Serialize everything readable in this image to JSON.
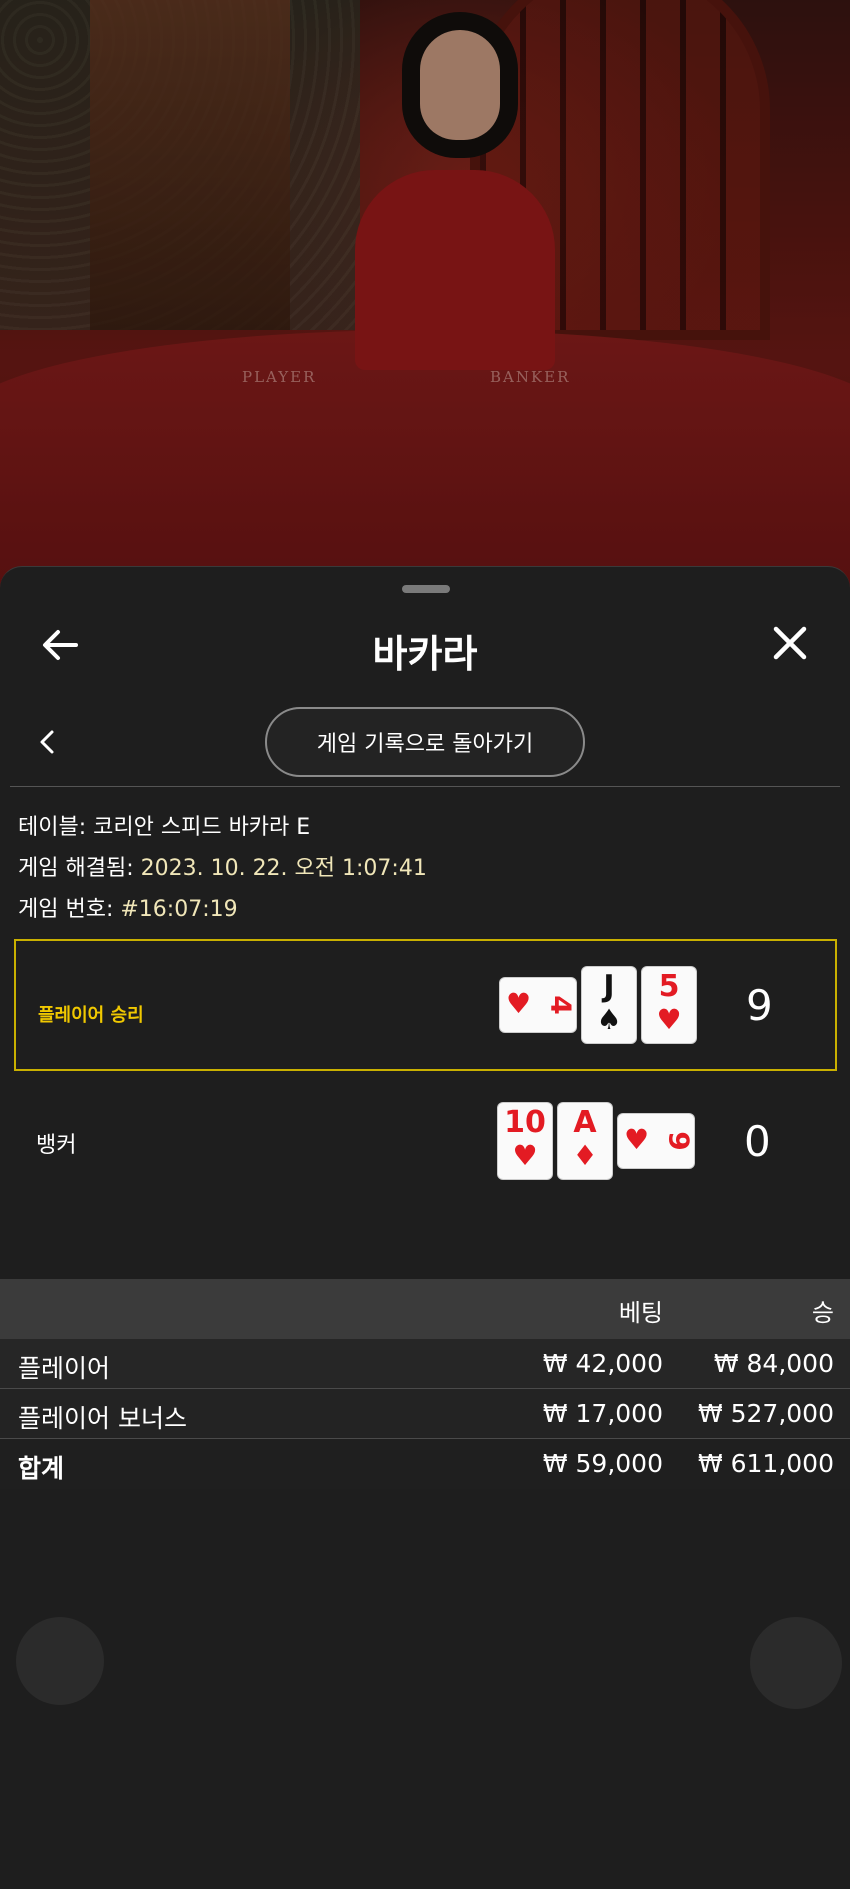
{
  "video": {
    "table_labels": [
      "PLAYER",
      "BANKER"
    ]
  },
  "sheet": {
    "title": "바카라",
    "back_icon": "arrow-left-icon",
    "close_icon": "close-icon",
    "history_button": "게임 기록으로 돌아가기",
    "info": {
      "table_label": "테이블:",
      "table_value": "코리안 스피드 바카라 E",
      "resolved_label": "게임 해결됨:",
      "resolved_value": "2023. 10. 22. 오전 1:07:41",
      "number_label": "게임 번호:",
      "number_value": "#16:07:19"
    },
    "results": {
      "player": {
        "label": "플레이어 승리",
        "cards": [
          {
            "rank": "4",
            "suit": "♥",
            "color": "#e31b23",
            "orientation": "side"
          },
          {
            "rank": "J",
            "suit": "♠",
            "color": "#111111",
            "orientation": "up"
          },
          {
            "rank": "5",
            "suit": "♥",
            "color": "#e31b23",
            "orientation": "up"
          }
        ],
        "score": "9"
      },
      "banker": {
        "label": "뱅커",
        "cards": [
          {
            "rank": "10",
            "suit": "♥",
            "color": "#e31b23",
            "orientation": "up"
          },
          {
            "rank": "A",
            "suit": "♦",
            "color": "#e31b23",
            "orientation": "up"
          },
          {
            "rank": "9",
            "suit": "♥",
            "color": "#e31b23",
            "orientation": "side"
          }
        ],
        "score": "0"
      }
    },
    "bets": {
      "headers": {
        "bet": "베팅",
        "win": "승"
      },
      "rows": [
        {
          "name": "플레이어",
          "bet": "₩ 42,000",
          "win": "₩ 84,000"
        },
        {
          "name": "플레이어 보너스",
          "bet": "₩ 17,000",
          "win": "₩ 527,000"
        },
        {
          "name": "합계",
          "bet": "₩ 59,000",
          "win": "₩ 611,000"
        }
      ]
    }
  },
  "colors": {
    "winner_border": "#c9b000",
    "winner_label": "#f0c800",
    "card_red": "#e31b23",
    "sheet_bg": "#1e1e1e"
  }
}
